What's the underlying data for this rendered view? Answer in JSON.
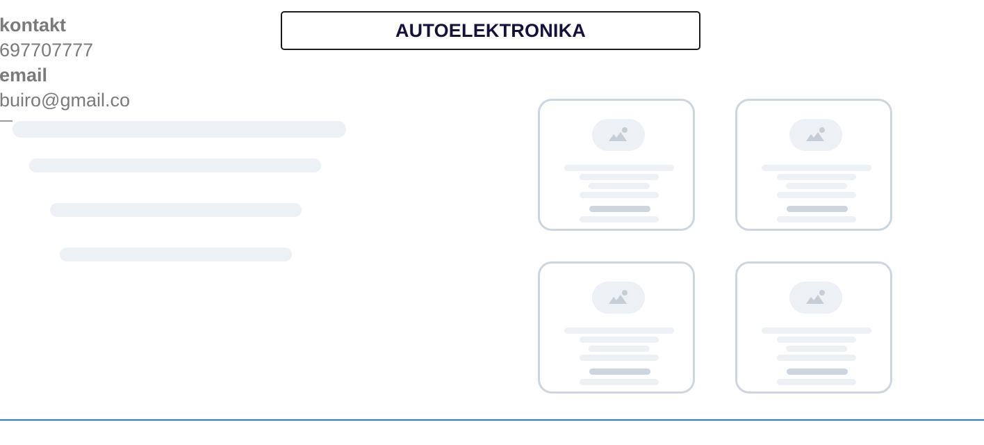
{
  "contact": {
    "label": "kontakt",
    "phone": "697707777",
    "email_label": "email",
    "email": "buiro@gmail.co"
  },
  "title": "AUTOELEKTRONIKA",
  "cards": [
    {
      "icon": "image-placeholder-icon"
    },
    {
      "icon": "image-placeholder-icon"
    },
    {
      "icon": "image-placeholder-icon"
    },
    {
      "icon": "image-placeholder-icon"
    }
  ],
  "colors": {
    "skeleton": "#edf0f4",
    "card_border": "#cdd5de",
    "title_text": "#14113a",
    "footer_rule": "#2a7cc7",
    "contact_text": "#7a7a7a"
  }
}
